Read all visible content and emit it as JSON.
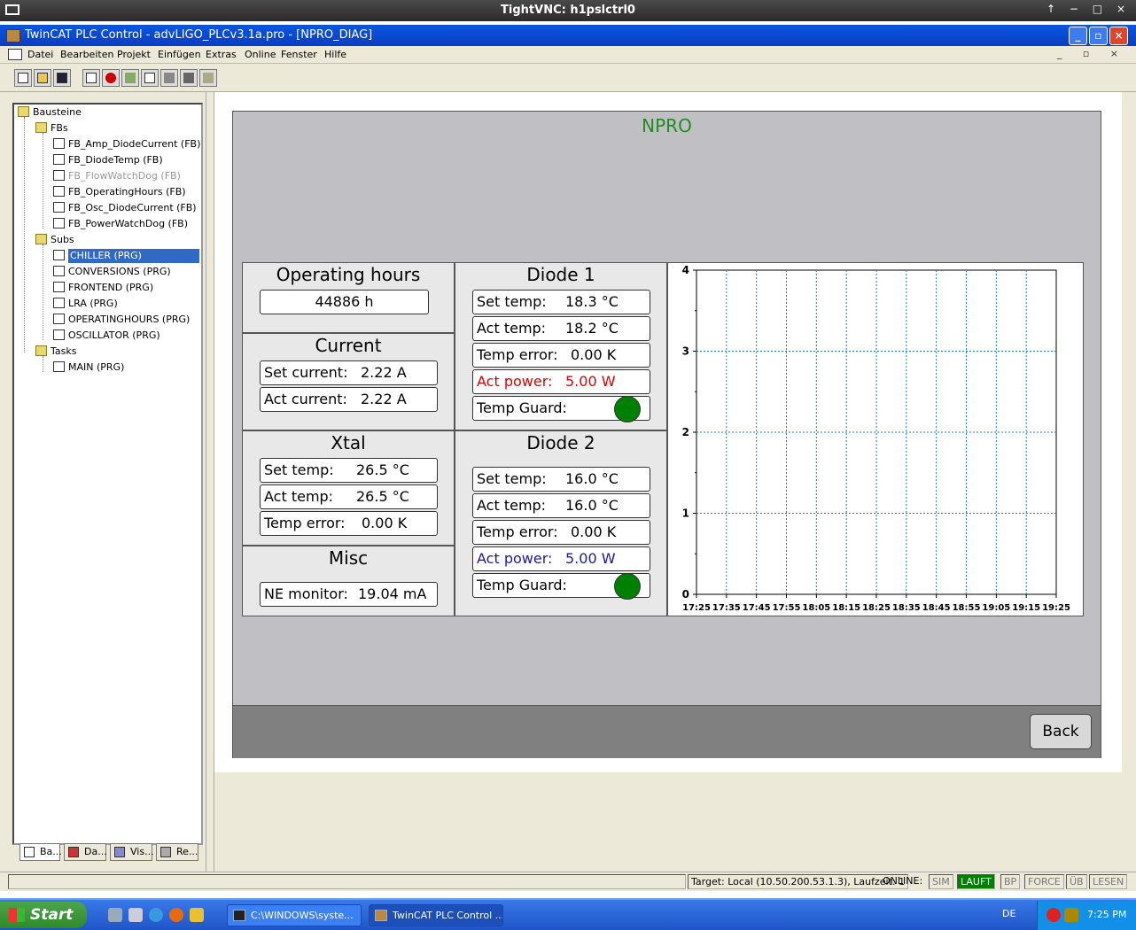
{
  "vnc": {
    "title": "TightVNC: h1pslctrl0",
    "controls": "↑ − □ ×"
  },
  "app": {
    "title": "TwinCAT PLC Control - advLIGO_PLCv3.1a.pro - [NPRO_DIAG]"
  },
  "menu": [
    "Datei",
    "Bearbeiten",
    "Projekt",
    "Einfügen",
    "Extras",
    "Online",
    "Fenster",
    "Hilfe"
  ],
  "mdi_controls": "_ ▫ ×",
  "tree": {
    "root": "Bausteine",
    "fbs_folder": "FBs",
    "fbs": [
      "FB_Amp_DiodeCurrent (FB)",
      "FB_DiodeTemp (FB)",
      "FB_FlowWatchDog (FB)",
      "FB_OperatingHours (FB)",
      "FB_Osc_DiodeCurrent (FB)",
      "FB_PowerWatchDog (FB)"
    ],
    "subs_folder": "Subs",
    "subs": [
      "CHILLER (PRG)",
      "CONVERSIONS (PRG)",
      "FRONTEND (PRG)",
      "LRA (PRG)",
      "OPERATINGHOURS (PRG)",
      "OSCILLATOR (PRG)"
    ],
    "tasks_folder": "Tasks",
    "tasks": [
      "MAIN (PRG)"
    ]
  },
  "left_tabs": [
    "Ba...",
    "Da...",
    "Vis...",
    "Re..."
  ],
  "vis": {
    "title": "NPRO",
    "operating_hours": {
      "header": "Operating hours",
      "value": "44886 h"
    },
    "current": {
      "header": "Current",
      "set_label": "Set current:",
      "set_value": "2.22 A",
      "act_label": "Act current:",
      "act_value": "2.22 A"
    },
    "xtal": {
      "header": "Xtal",
      "set_label": "Set temp:",
      "set_value": "26.5 °C",
      "act_label": "Act temp:",
      "act_value": "26.5 °C",
      "err_label": "Temp error:",
      "err_value": "0.00 K"
    },
    "misc": {
      "header": "Misc",
      "ne_label": "NE monitor:",
      "ne_value": "19.04 mA"
    },
    "diode1": {
      "header": "Diode 1",
      "set_label": "Set temp:",
      "set_value": "18.3 °C",
      "act_label": "Act temp:",
      "act_value": "18.2 °C",
      "err_label": "Temp error:",
      "err_value": "0.00 K",
      "power_label": "Act power:",
      "power_value": "5.00 W",
      "guard_label": "Temp Guard:"
    },
    "diode2": {
      "header": "Diode 2",
      "set_label": "Set temp:",
      "set_value": "16.0 °C",
      "act_label": "Act temp:",
      "act_value": "16.0 °C",
      "err_label": "Temp error:",
      "err_value": "0.00 K",
      "power_label": "Act power:",
      "power_value": "5.00 W",
      "guard_label": "Temp Guard:"
    },
    "back_label": "Back",
    "colors": {
      "title": "#228b22",
      "power_alarm": "#e00000",
      "power_ok": "#1a1aa0",
      "guard_ok": "#008000"
    }
  },
  "chart_data": {
    "type": "line",
    "x": [
      "17:25",
      "17:35",
      "17:45",
      "17:55",
      "18:05",
      "18:15",
      "18:25",
      "18:35",
      "18:45",
      "18:55",
      "19:05",
      "19:15",
      "19:25"
    ],
    "ylim": [
      0,
      4
    ],
    "yticks": [
      "0",
      "1",
      "2",
      "3",
      "4"
    ],
    "series": [],
    "grid": true
  },
  "status": {
    "target": "Target: Local (10.50.200.53.1.3), Laufzeit: 1",
    "online": "ONLINE:",
    "sim": "SIM",
    "lauft": "LAUFT",
    "bp": "BP",
    "force": "FORCE",
    "ub": "ÜB",
    "lesen": "LESEN"
  },
  "taskbar": {
    "start": "Start",
    "tasks": [
      "C:\\WINDOWS\\syste...",
      "TwinCAT PLC Control ..."
    ],
    "lang": "DE",
    "clock": "7:25 PM"
  }
}
